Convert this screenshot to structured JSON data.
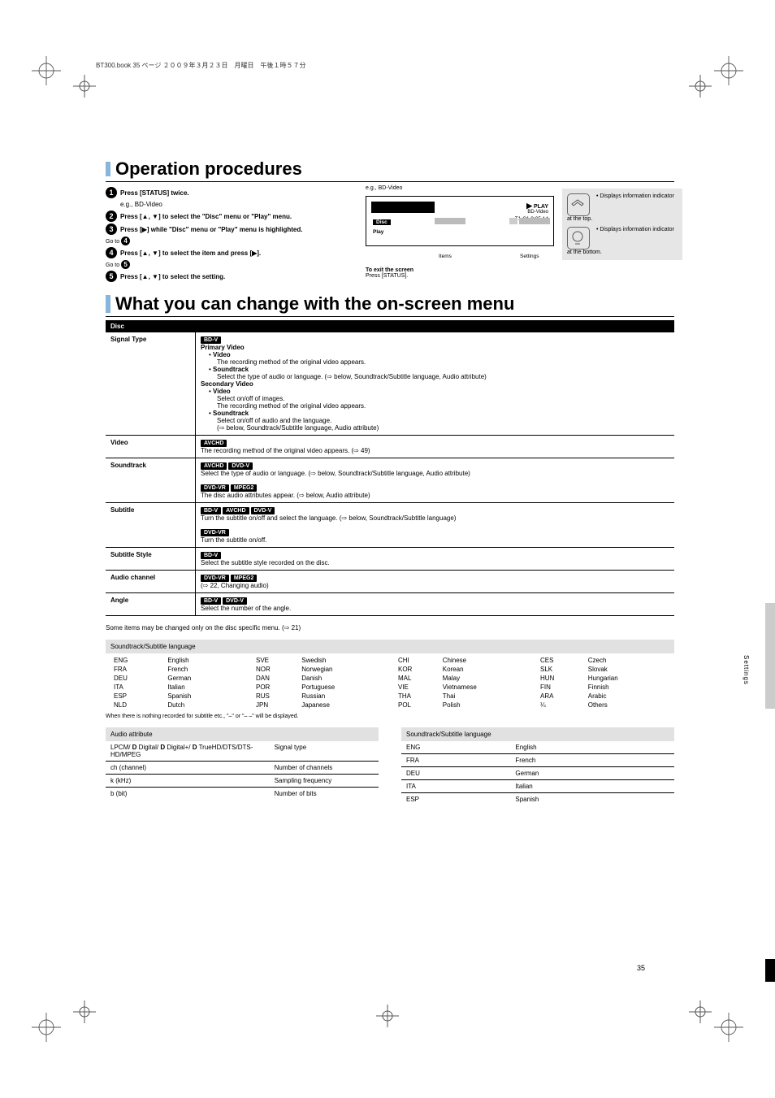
{
  "header": "BT300.book  35 ページ  ２００９年３月２３日　月曜日　午後１時５７分",
  "pagenum": "35",
  "sideTab": "Settings",
  "proc": {
    "title": "Operation procedures",
    "step1": "Press [STATUS] twice.",
    "step2note": "e.g., BD-Video",
    "step2": "Press [▲, ▼] to select the \"Disc\" menu or \"Play\" menu.",
    "step3": "Press [▶] while \"Disc\" menu or \"Play\" menu is highlighted.",
    "step4": "Press [▲, ▼] to select the item and press [▶].",
    "step5": "Press [▲, ▼] to select the setting.",
    "egLabel": "e.g., BD-Video",
    "status": "PLAY",
    "bdv": "BD-Video",
    "time": "T1    C1                0:05.14",
    "discLabel": "Disc",
    "playLabel": "Play",
    "genericItem": "Items",
    "genericSetting": "Settings",
    "infoIcon": "Displays information indicator at the top.",
    "infoLamp": "Displays information indicator at the bottom.",
    "exit": "To exit the screen",
    "exitHow": "Press [STATUS]."
  },
  "can": {
    "title": "What you can change with the on-screen menu",
    "hDisc": "Disc",
    "signal": {
      "name": "Signal Type",
      "pv": "Primary Video",
      "vid": "Video",
      "vidDesc": "The recording method of the original video appears.",
      "st": "Soundtrack",
      "stDesc": "Select the type of audio or language. (⇨ below, Soundtrack/Subtitle language, Audio attribute)",
      "sv": "Secondary Video",
      "vid2": "Video",
      "vid2Desc": "Select on/off of images. The recording method of the original video appears.",
      "st2": "Soundtrack",
      "st2Desc": "Select on/off of audio and the language. (⇨ below, Soundtrack/Subtitle language, Audio attribute)"
    },
    "video": {
      "name": "Video",
      "body": "The recording method of the original video appears. (⇨ 49)"
    },
    "soundtrack": {
      "name": "Soundtrack",
      "body": "Select the type of audio or language. (⇨ below, Soundtrack/Subtitle language, Audio attribute)",
      "bodyB": "The disc audio attributes appear. (⇨ below, Audio attribute)"
    },
    "subtitle": {
      "name": "Subtitle",
      "body": "Turn the subtitle on/off and select the language. (⇨ below, Soundtrack/Subtitle language)",
      "bodyB": "Turn the subtitle on/off."
    },
    "subStyle": {
      "name": "Subtitle Style",
      "body": "Select the subtitle style recorded on the disc."
    },
    "audioCh": {
      "name": "Audio channel",
      "body": "(⇨ 22, Changing audio)"
    },
    "angle": {
      "name": "Angle",
      "body": "Select the number of the angle."
    },
    "note": "Some items may be changed only on the disc specific menu. (⇨ 21)",
    "lang": {
      "title": "Soundtrack/Subtitle language",
      "r": [
        [
          "ENG",
          "English"
        ],
        [
          "FRA",
          "French"
        ],
        [
          "DEU",
          "German"
        ],
        [
          "ITA",
          "Italian"
        ],
        [
          "ESP",
          "Spanish"
        ],
        [
          "NLD",
          "Dutch"
        ],
        [
          "SVE",
          "Swedish"
        ],
        [
          "NOR",
          "Norwegian"
        ],
        [
          "DAN",
          "Danish"
        ],
        [
          "POR",
          "Portuguese"
        ],
        [
          "RUS",
          "Russian"
        ],
        [
          "JPN",
          "Japanese"
        ],
        [
          "CHI",
          "Chinese"
        ],
        [
          "KOR",
          "Korean"
        ],
        [
          "MAL",
          "Malay"
        ],
        [
          "VIE",
          "Vietnamese"
        ],
        [
          "THA",
          "Thai"
        ],
        [
          "POL",
          "Polish"
        ],
        [
          "CES",
          "Czech"
        ],
        [
          "SLK",
          "Slovak"
        ],
        [
          "HUN",
          "Hungarian"
        ],
        [
          "FIN",
          "Finnish"
        ],
        [
          "ARA",
          "Arabic"
        ],
        [
          "¼",
          "Others"
        ]
      ],
      "t1": "When there is nothing recorded for subtitle etc., \"–\" or \"– –\" will be displayed."
    },
    "audioAttr": {
      "title": "Audio attribute",
      "rows": [
        [
          "LPCM/ 𝇍 Digital/ 𝇍 Digital+/ 𝇍 TrueHD/DTS/DTS-HD/MPEG",
          "Signal type"
        ],
        [
          "ch (channel)",
          "Number of channels"
        ],
        [
          "k (kHz)",
          "Sampling frequency"
        ],
        [
          "b (bit)",
          "Number of bits"
        ]
      ]
    }
  }
}
